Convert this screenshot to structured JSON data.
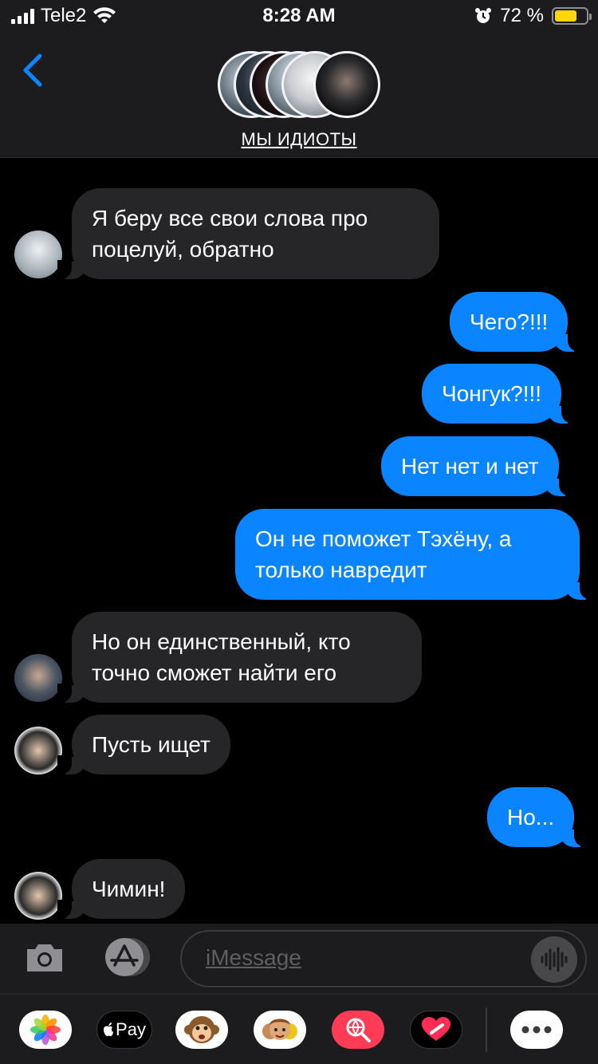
{
  "status_bar": {
    "carrier": "Tele2",
    "time": "8:28 AM",
    "battery_percent": "72 %",
    "battery_level": 0.72
  },
  "header": {
    "group_name": "МЫ ИДИОТЫ",
    "back_icon": "chevron-left-icon"
  },
  "messages": [
    {
      "from": "in",
      "text": "Я беру все свои слова про поцелуй, обратно"
    },
    {
      "from": "out",
      "text": "Чего?!!!"
    },
    {
      "from": "out",
      "text": "Чонгук?!!!"
    },
    {
      "from": "out",
      "text": "Нет нет и нет"
    },
    {
      "from": "out",
      "text": "Он не поможет Тэхёну, а только навредит"
    },
    {
      "from": "in",
      "text": "Но он единственный, кто точно сможет найти его"
    },
    {
      "from": "in",
      "text": "Пусть ищет"
    },
    {
      "from": "out",
      "text": "Но..."
    },
    {
      "from": "in",
      "text": "Чимин!"
    }
  ],
  "input": {
    "placeholder": "iMessage"
  },
  "app_drawer": {
    "apple_pay_label": "Pay",
    "items": [
      "photos-icon",
      "apple-pay-icon",
      "monkey-animoji-icon",
      "memoji-icon",
      "search-images-icon",
      "digital-touch-icon",
      "more-icon"
    ]
  },
  "colors": {
    "outgoing_bubble": "#0a84ff",
    "incoming_bubble": "#262628",
    "accent": "#0a84ff"
  }
}
